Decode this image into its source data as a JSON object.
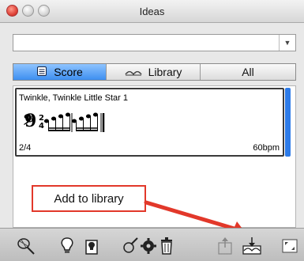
{
  "window": {
    "title": "Ideas"
  },
  "combo": {
    "value": ""
  },
  "tabs": [
    {
      "label": "Score",
      "icon": "score-icon",
      "active": true
    },
    {
      "label": "Library",
      "icon": "library-icon",
      "active": false
    },
    {
      "label": "All",
      "active": false
    }
  ],
  "item": {
    "title": "Twinkle, Twinkle Little Star 1",
    "meter": "2/4",
    "tempo": "60bpm"
  },
  "callout": {
    "text": "Add to library"
  },
  "toolbar": {
    "icons": [
      "tune-fork-icon",
      "lightbulb-icon",
      "lightbulb-bag-icon",
      "edit-tag-icon",
      "settings-gear-icon",
      "trash-icon",
      "export-icon",
      "add-to-library-icon",
      "resize-icon"
    ]
  },
  "colors": {
    "accent": "#3d8ef0",
    "callout_border": "#e2382a",
    "arrow": "#e2382a"
  }
}
